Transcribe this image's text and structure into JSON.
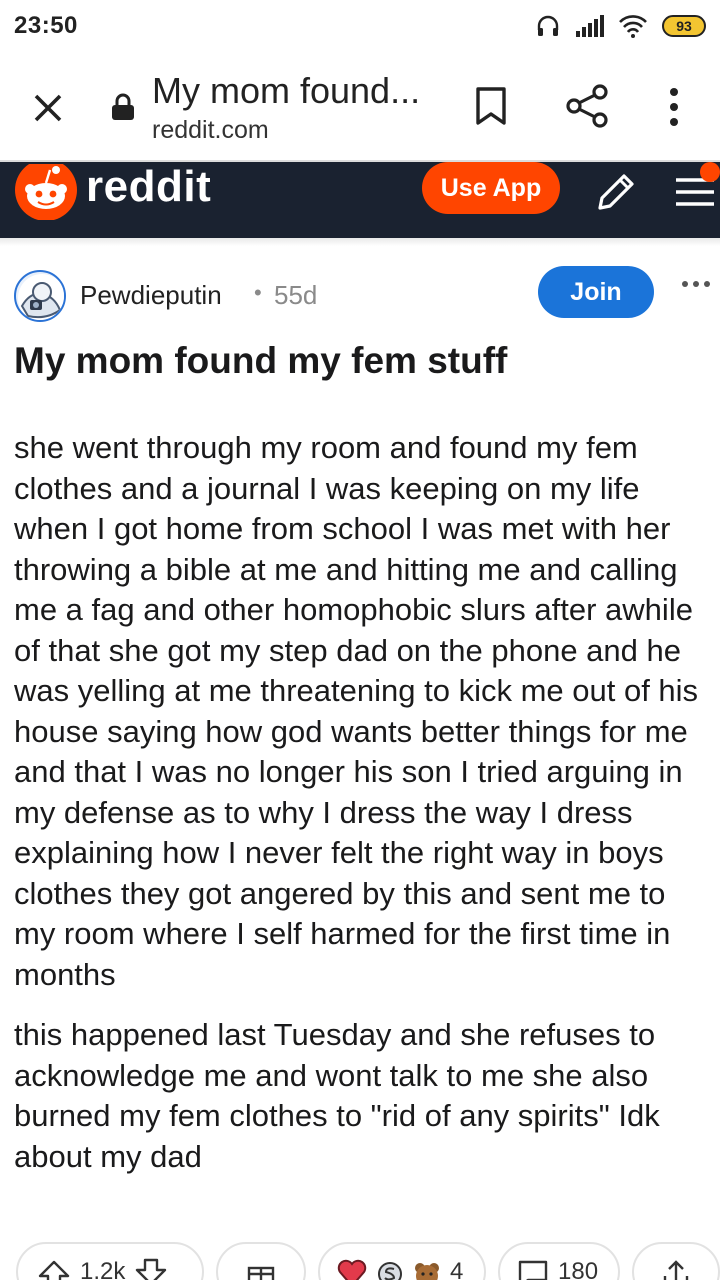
{
  "status_bar": {
    "time": "23:50",
    "battery": "93",
    "icons": [
      "headphones-icon",
      "signal-icon",
      "wifi-icon",
      "battery-icon"
    ]
  },
  "browser": {
    "page_title": "My mom found...",
    "domain": "reddit.com",
    "icons": [
      "close-icon",
      "lock-icon",
      "bookmark-icon",
      "share-icon",
      "more-vert-icon"
    ]
  },
  "reddit_header": {
    "wordmark": "reddit",
    "use_app_label": "Use App",
    "brand_color": "#ff4500",
    "bg_color": "#1a2230"
  },
  "post": {
    "author": "Pewdieputin",
    "separator": "•",
    "age": "55d",
    "join_label": "Join",
    "join_color": "#1b74d9",
    "title": "My mom found my fem stuff",
    "paragraphs": [
      "she went through my room and found my fem clothes and a journal I was keeping on my life when I got home from school I was met with her throwing a bible at me and hitting me and calling me a fag and other homophobic slurs after awhile of that she got my step dad on the phone and he was yelling at me threatening to kick me out of his house saying how god wants better things for me and that I was no longer his son I tried arguing in my defense as to why I dress the way I dress explaining how I never felt the right way in boys clothes they got angered by this and sent me to my room where I self harmed for the first time in months",
      "this happened last Tuesday and she refuses to acknowledge me and wont talk to me she also burned my fem clothes to \"rid of any spirits\" Idk about my dad"
    ]
  },
  "actions": {
    "votes": "1.2k",
    "awards_count": "4",
    "comments": "180"
  }
}
